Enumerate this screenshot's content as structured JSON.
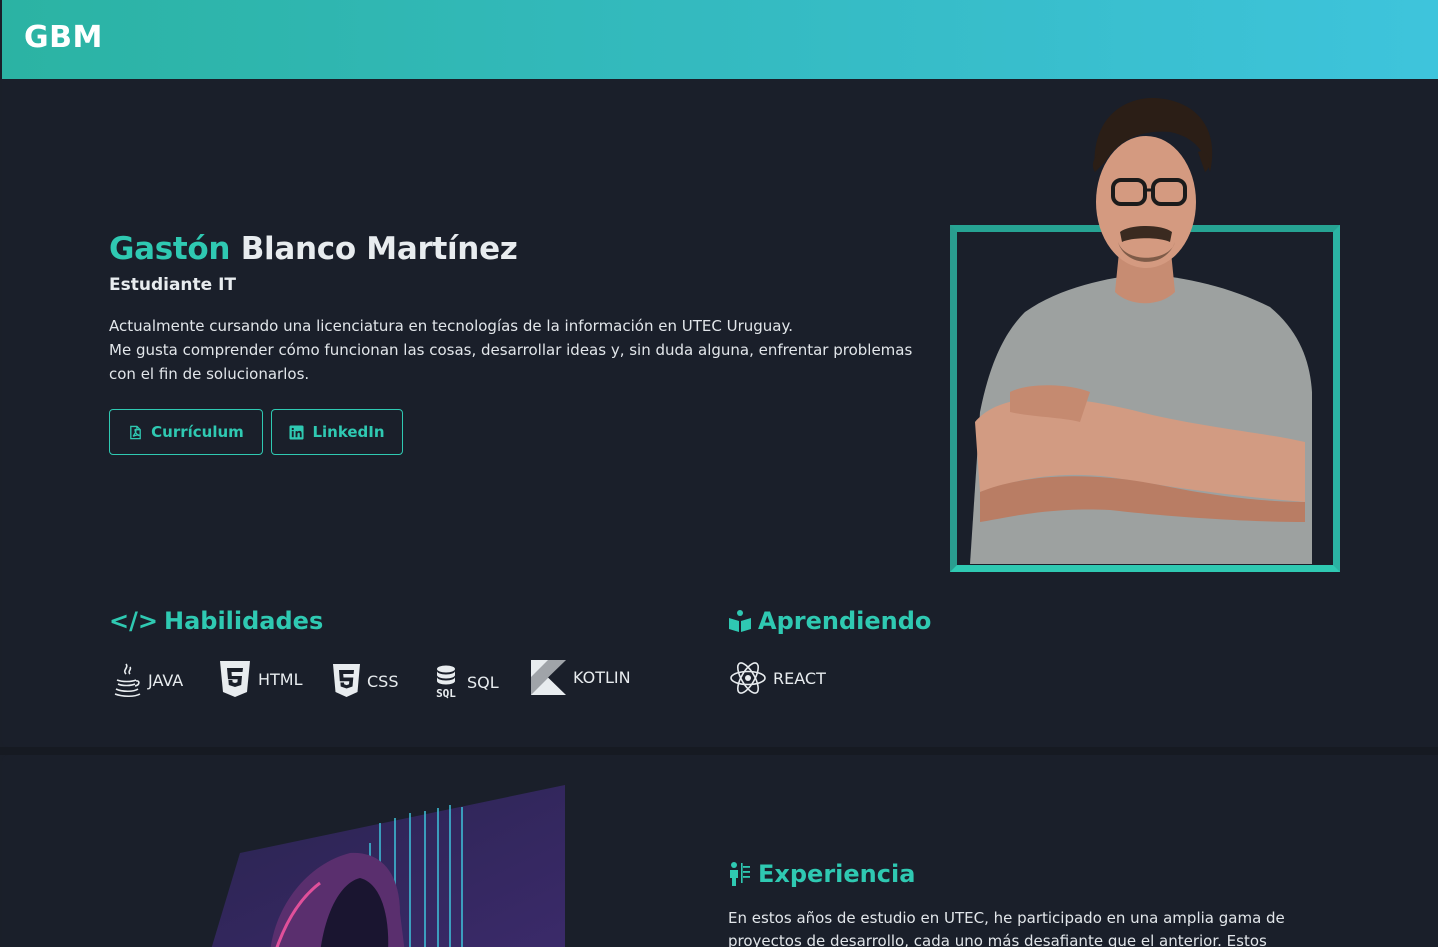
{
  "header": {
    "brand": "GBM"
  },
  "hero": {
    "first_name": "Gastón",
    "last_name": "Blanco Martínez",
    "role": "Estudiante IT",
    "bio_line1": "Actualmente cursando una licenciatura en tecnologías de la información en UTEC Uruguay.",
    "bio_line2": "Me gusta comprender cómo funcionan las cosas, desarrollar ideas y, sin duda alguna, enfrentar problemas con el fin de solucionarlos.",
    "buttons": {
      "cv": "Currículum",
      "linkedin": "LinkedIn"
    }
  },
  "skills": {
    "title": "Habilidades",
    "items": [
      {
        "label": "JAVA",
        "icon": "java-icon"
      },
      {
        "label": "HTML",
        "icon": "html5-icon"
      },
      {
        "label": "CSS",
        "icon": "css3-icon"
      },
      {
        "label": "SQL",
        "icon": "sql-icon"
      },
      {
        "label": "KOTLIN",
        "icon": "kotlin-icon"
      }
    ]
  },
  "learning": {
    "title": "Aprendiendo",
    "items": [
      {
        "label": "REACT",
        "icon": "react-icon"
      }
    ]
  },
  "experience": {
    "title": "Experiencia",
    "text": "En estos años de estudio en UTEC, he participado en una amplia gama de proyectos de desarrollo, cada uno más desafiante que el anterior. Estos"
  },
  "colors": {
    "accent": "#2fc9b2",
    "background": "#1a1f29",
    "header_start": "#2bb3a3",
    "header_end": "#3ec4dc"
  }
}
